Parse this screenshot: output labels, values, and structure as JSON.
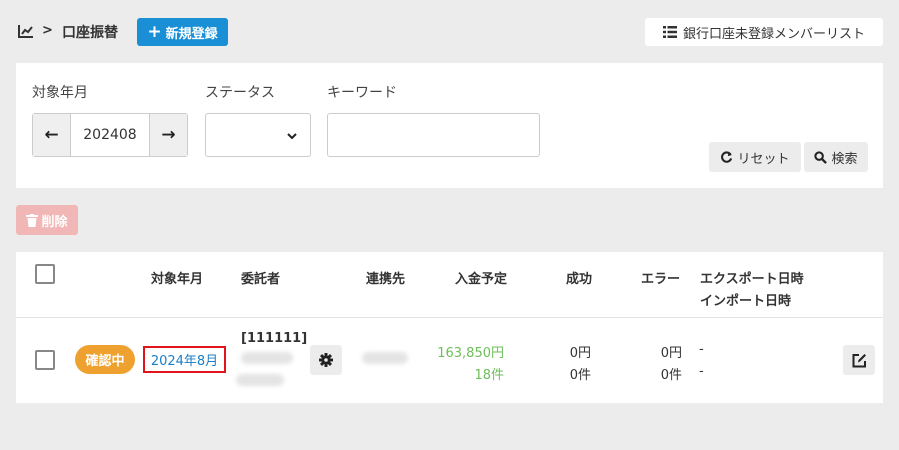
{
  "header": {
    "breadcrumb_sep": ">",
    "title": "口座振替",
    "new_button_label": "新規登録",
    "bank_list_button_label": "銀行口座未登録メンバーリスト"
  },
  "filters": {
    "target_month_label": "対象年月",
    "target_month_value": "202408",
    "status_label": "ステータス",
    "status_value": "",
    "keyword_label": "キーワード",
    "keyword_value": "",
    "reset_label": "リセット",
    "search_label": "検索"
  },
  "toolbar": {
    "delete_label": "削除"
  },
  "table": {
    "headers": {
      "target_month": "対象年月",
      "consignor": "委託者",
      "partner": "連携先",
      "planned_deposit": "入金予定",
      "success": "成功",
      "error": "エラー",
      "export_date": "エクスポート日時",
      "import_date": "インポート日時"
    },
    "rows": [
      {
        "status": "確認中",
        "target_month": "2024年8月",
        "consignor_id": "[111111]",
        "planned_amount": "163,850円",
        "planned_count": "18件",
        "success_amount": "0円",
        "success_count": "0件",
        "error_amount": "0円",
        "error_count": "0件",
        "export_date": "-",
        "import_date": "-"
      }
    ]
  },
  "colors": {
    "primary": "#1a8fd6",
    "badge": "#efa12f",
    "link": "#1b7ec6",
    "amount_green": "#6cbf5a",
    "highlight_border": "#e0141a",
    "delete_disabled": "#f1b7b7"
  }
}
